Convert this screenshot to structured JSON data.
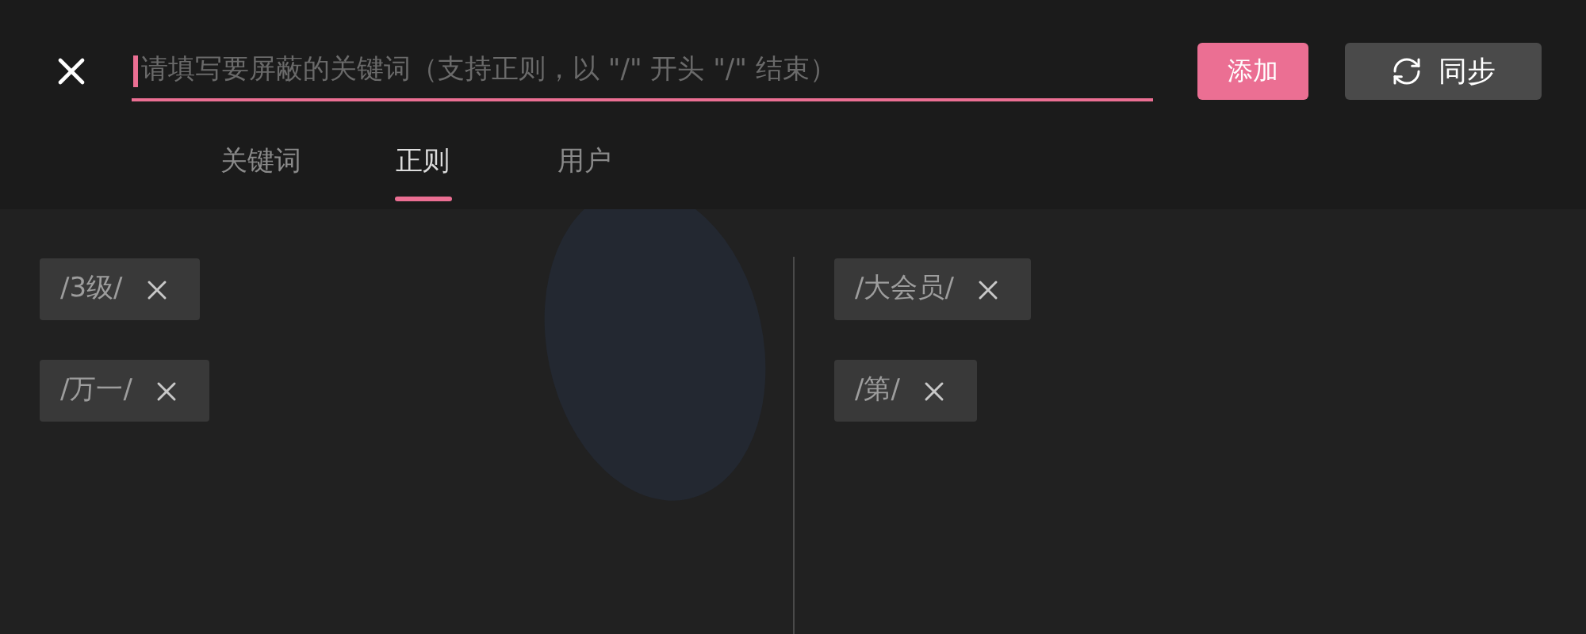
{
  "search": {
    "placeholder": "请填写要屏蔽的关键词（支持正则，以 \"/\" 开头 \"/\" 结束）"
  },
  "buttons": [
    {
      "kind": "add",
      "label": "添加"
    },
    {
      "kind": "sync",
      "label": "同步"
    }
  ],
  "tabs": [
    {
      "label": "关键词",
      "selected": false
    },
    {
      "label": "正则",
      "selected": true
    },
    {
      "label": "用户",
      "selected": false
    }
  ],
  "columns": [
    [
      {
        "label": "/3级/"
      },
      {
        "label": "/万一/"
      }
    ],
    [
      {
        "label": "/大会员/"
      },
      {
        "label": "/第/"
      }
    ]
  ]
}
